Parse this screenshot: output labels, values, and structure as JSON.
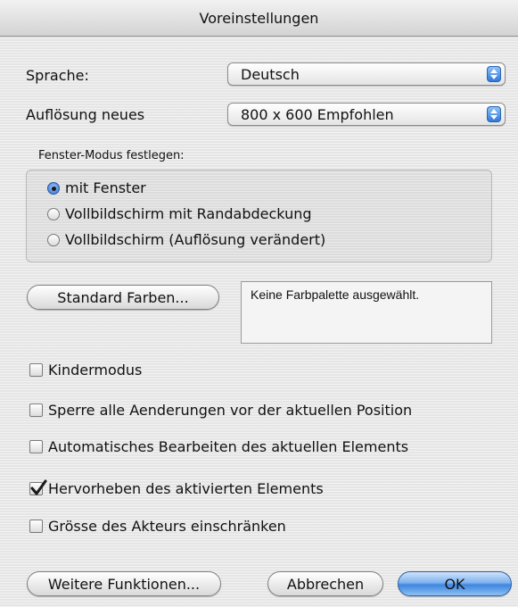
{
  "window": {
    "title": "Voreinstellungen"
  },
  "language": {
    "label": "Sprache:",
    "value": "Deutsch"
  },
  "resolution": {
    "label": "Auflösung neues",
    "value": "800 x 600 Empfohlen"
  },
  "window_mode": {
    "label": "Fenster-Modus festlegen:",
    "options": [
      {
        "label": "mit Fenster",
        "selected": true
      },
      {
        "label": "Vollbildschirm mit Randabdeckung",
        "selected": false
      },
      {
        "label": "Vollbildschirm (Auflösung verändert)",
        "selected": false
      }
    ]
  },
  "colors": {
    "button_label": "Standard Farben...",
    "status_text": "Keine Farbpalette ausgewählt."
  },
  "options": [
    {
      "label": "Kindermodus",
      "checked": false
    },
    {
      "label": "Sperre alle Aenderungen vor der aktuellen Position",
      "checked": false
    },
    {
      "label": "Automatisches Bearbeiten des aktuellen Elements",
      "checked": false
    },
    {
      "label": "Hervorheben des aktivierten Elements",
      "checked": true
    },
    {
      "label": "Grösse des Akteurs einschränken",
      "checked": false
    }
  ],
  "buttons": {
    "more_label": "Weitere Funktionen...",
    "cancel_label": "Abbrechen",
    "ok_label": "OK"
  },
  "accent_color": "#3f86e0"
}
